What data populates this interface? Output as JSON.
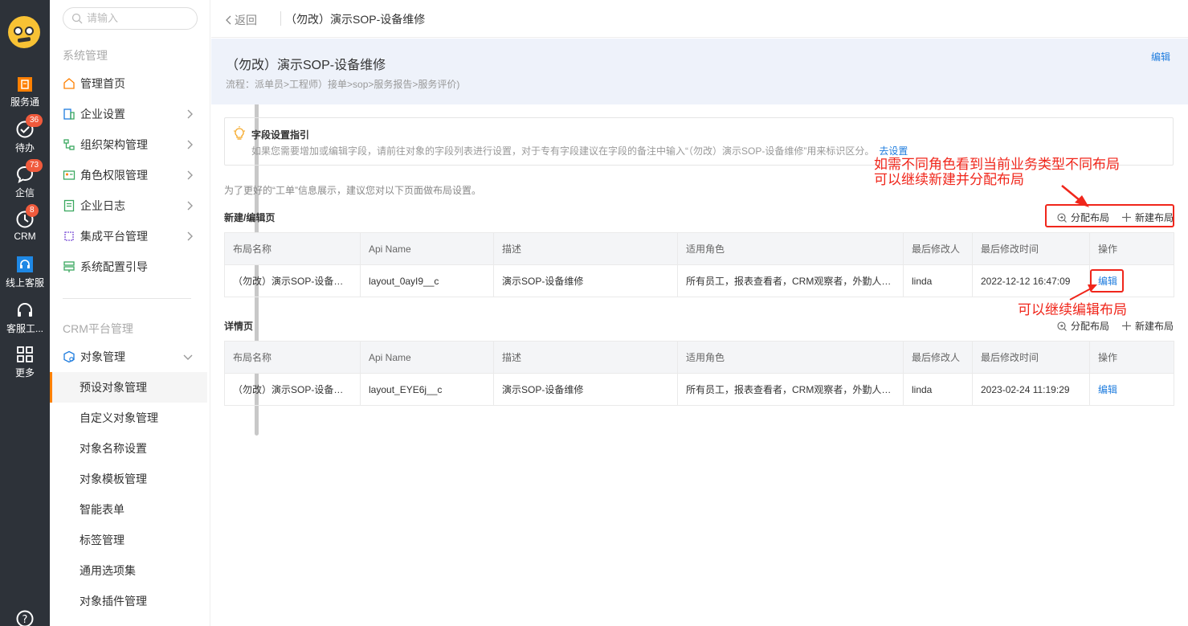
{
  "rail": {
    "items": [
      {
        "label": "服务通",
        "icon": "service-icon"
      },
      {
        "label": "待办",
        "icon": "check-circle-icon",
        "badge": "36"
      },
      {
        "label": "企信",
        "icon": "chat-bubble-icon",
        "badge": "73"
      },
      {
        "label": "CRM",
        "icon": "crm-icon",
        "badge": "8"
      },
      {
        "label": "线上客服",
        "icon": "headset-icon"
      },
      {
        "label": "客服工...",
        "icon": "headphones-icon"
      },
      {
        "label": "更多",
        "icon": "grid-icon"
      }
    ],
    "help_icon": "question-icon"
  },
  "sidebar": {
    "search_placeholder": "请输入",
    "section1": "系统管理",
    "items1": [
      {
        "label": "管理首页",
        "icon": "home-icon"
      },
      {
        "label": "企业设置",
        "icon": "building-icon"
      },
      {
        "label": "组织架构管理",
        "icon": "org-tree-icon"
      },
      {
        "label": "角色权限管理",
        "icon": "role-card-icon"
      },
      {
        "label": "企业日志",
        "icon": "log-icon"
      },
      {
        "label": "集成平台管理",
        "icon": "chip-icon"
      },
      {
        "label": "系统配置引导",
        "icon": "signpost-icon"
      }
    ],
    "section2": "CRM平台管理",
    "object_mgmt": "对象管理",
    "sub_items": [
      "预设对象管理",
      "自定义对象管理",
      "对象名称设置",
      "对象模板管理",
      "智能表单",
      "标签管理",
      "通用选项集",
      "对象插件管理"
    ]
  },
  "topbar": {
    "back": "返回",
    "title": "（勿改）演示SOP-设备维修"
  },
  "header": {
    "title": "（勿改）演示SOP-设备维修",
    "flow": "流程：派单员>工程师）接单>sop>服务报告>服务评价)",
    "edit": "编辑"
  },
  "guide": {
    "title": "字段设置指引",
    "desc": "如果您需要增加或编辑字段，请前往对象的字段列表进行设置，对于专有字段建议在字段的备注中输入“（勿改）演示SOP-设备维修”用来标识区分。",
    "link": "去设置"
  },
  "hint": "为了更好的“工单”信息展示，建议您对以下页面做布局设置。",
  "actions": {
    "assign": "分配布局",
    "new": "新建布局"
  },
  "columns": [
    "布局名称",
    "Api Name",
    "描述",
    "适用角色",
    "最后修改人",
    "最后修改时间",
    "操作"
  ],
  "edit_section": {
    "title": "新建/编辑页",
    "row": [
      "（勿改）演示SOP-设备…",
      "layout_0ayI9__c",
      "演示SOP-设备维修",
      "所有员工，报表查看者，CRM观察者，外勤人…",
      "linda",
      "2022-12-12 16:47:09",
      "编辑"
    ]
  },
  "detail_section": {
    "title": "详情页",
    "row": [
      "（勿改）演示SOP-设备…",
      "layout_EYE6j__c",
      "演示SOP-设备维修",
      "所有员工，报表查看者，CRM观察者，外勤人…",
      "linda",
      "2023-02-24 11:19:29",
      "编辑"
    ]
  },
  "annotations": {
    "line1": "如需不同角色看到当前业务类型不同布局",
    "line2": "可以继续新建并分配布局",
    "edit_note": "可以继续编辑布局"
  },
  "colors": {
    "accent": "#1e7cde",
    "annotation": "#f0261b",
    "rail": "#2d3239",
    "active": "#ff8000"
  }
}
